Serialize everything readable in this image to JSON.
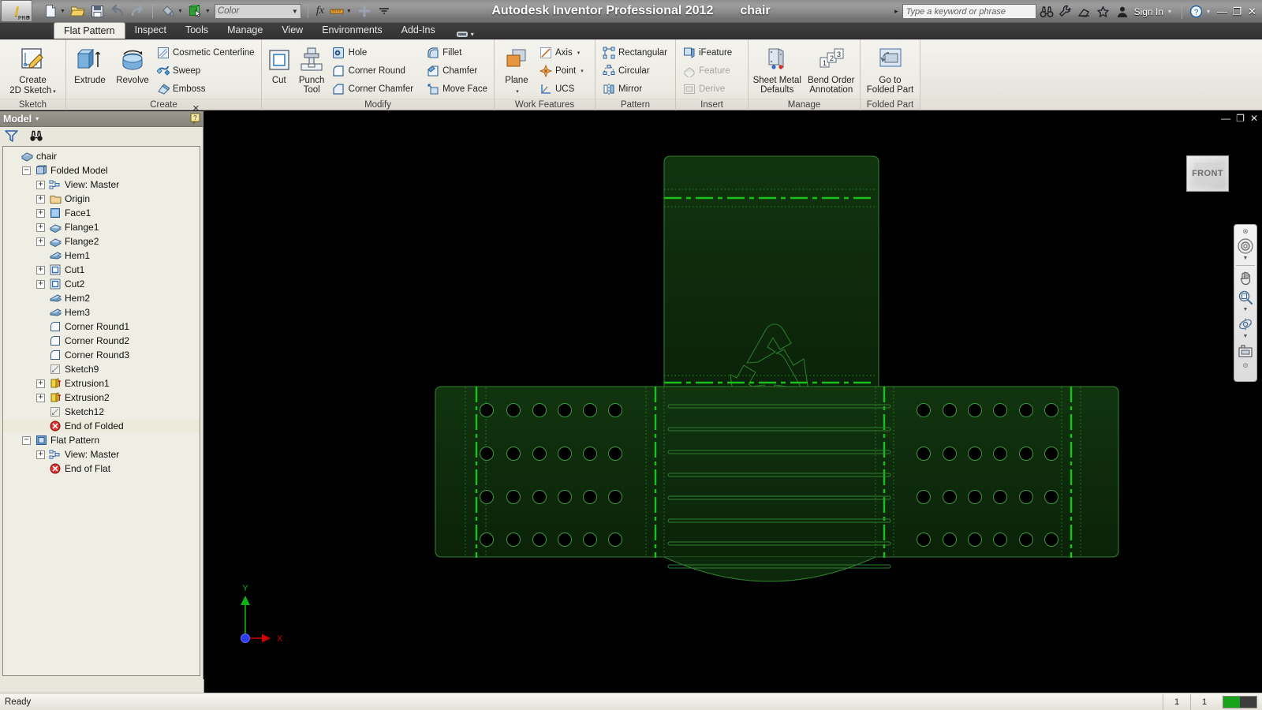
{
  "titlebar": {
    "app_logo": "inventor-logo",
    "pro_badge": "PRO",
    "quick_access": [
      {
        "name": "new-file",
        "icon": "new-document-icon",
        "has_dropdown": true
      },
      {
        "name": "open-file",
        "icon": "open-folder-icon",
        "has_dropdown": false
      },
      {
        "name": "save-file",
        "icon": "save-disk-icon",
        "has_dropdown": false
      },
      {
        "name": "undo",
        "icon": "undo-arrow-icon",
        "has_dropdown": false
      },
      {
        "name": "redo",
        "icon": "redo-arrow-icon",
        "has_dropdown": false
      },
      {
        "name": "appearance",
        "icon": "paint-bucket-icon",
        "has_dropdown": true
      },
      {
        "name": "material",
        "icon": "material-box-icon",
        "has_dropdown": true
      }
    ],
    "color_combo": {
      "value": "Color",
      "arrow": "▼"
    },
    "fx_label": "fx",
    "measure_icon": "ruler-icon",
    "plus_icon": "plus-icon",
    "more_icon": "more-arrow-icon",
    "title": "Autodesk Inventor Professional 2012",
    "document": "chair",
    "doc_caret": "▸",
    "search_placeholder": "Type a keyword or phrase",
    "right_icons": [
      {
        "name": "search-binoculars",
        "icon": "binoculars-icon"
      },
      {
        "name": "help-wrench",
        "icon": "wrench-icon"
      },
      {
        "name": "subscription",
        "icon": "satellite-icon"
      },
      {
        "name": "favorites",
        "icon": "star-icon"
      }
    ],
    "sign_in": "Sign In",
    "sign_in_caret": "▾",
    "help_caret": "▾",
    "window_buttons": {
      "minimize": "—",
      "restore": "❐",
      "close": "✕"
    }
  },
  "tabs": {
    "items": [
      {
        "label": "Flat Pattern",
        "active": true
      },
      {
        "label": "Inspect",
        "active": false
      },
      {
        "label": "Tools",
        "active": false
      },
      {
        "label": "Manage",
        "active": false
      },
      {
        "label": "View",
        "active": false
      },
      {
        "label": "Environments",
        "active": false
      },
      {
        "label": "Add-Ins",
        "active": false
      }
    ],
    "extra_icon": "panel-display-icon",
    "extra_caret": "▾"
  },
  "ribbon": {
    "panels": [
      {
        "title": "Sketch",
        "big_buttons": [
          {
            "label": "Create\n2D Sketch",
            "label_line1": "Create",
            "label_line2": "2D Sketch",
            "icon": "create-sketch-icon",
            "has_dropdown": true
          }
        ],
        "small_buttons": []
      },
      {
        "title": "Create",
        "big_buttons": [
          {
            "label_line1": "Extrude",
            "label_line2": "",
            "icon": "extrude-icon",
            "has_dropdown": false
          },
          {
            "label_line1": "Revolve",
            "label_line2": "",
            "icon": "revolve-icon",
            "has_dropdown": false
          }
        ],
        "small_buttons": [
          {
            "label": "Cosmetic Centerline",
            "icon": "cosmetic-centerline-icon",
            "disabled": false
          },
          {
            "label": "Sweep",
            "icon": "sweep-icon",
            "disabled": false
          },
          {
            "label": "Emboss",
            "icon": "emboss-icon",
            "disabled": false
          }
        ]
      },
      {
        "title": "Modify",
        "big_buttons": [
          {
            "label_line1": "Cut",
            "label_line2": "",
            "icon": "cut-icon",
            "has_dropdown": false
          },
          {
            "label_line1": "Punch",
            "label_line2": "Tool",
            "icon": "punch-tool-icon",
            "has_dropdown": false
          }
        ],
        "small_buttons": [
          {
            "label": "Hole",
            "icon": "hole-icon",
            "disabled": false
          },
          {
            "label": "Corner Round",
            "icon": "corner-round-icon",
            "disabled": false
          },
          {
            "label": "Corner Chamfer",
            "icon": "corner-chamfer-icon",
            "disabled": false
          }
        ],
        "small_buttons2": [
          {
            "label": "Fillet",
            "icon": "fillet-icon",
            "disabled": false
          },
          {
            "label": "Chamfer",
            "icon": "chamfer-icon",
            "disabled": false
          },
          {
            "label": "Move Face",
            "icon": "move-face-icon",
            "disabled": false
          }
        ]
      },
      {
        "title": "Work Features",
        "big_buttons": [
          {
            "label_line1": "Plane",
            "label_line2": "",
            "icon": "work-plane-icon",
            "has_dropdown": true
          }
        ],
        "small_buttons": [
          {
            "label": "Axis",
            "icon": "work-axis-icon",
            "disabled": false,
            "has_dropdown": true
          },
          {
            "label": "Point",
            "icon": "work-point-icon",
            "disabled": false,
            "has_dropdown": true
          },
          {
            "label": "UCS",
            "icon": "ucs-icon",
            "disabled": false,
            "has_dropdown": false
          }
        ]
      },
      {
        "title": "Pattern",
        "small_buttons": [
          {
            "label": "Rectangular",
            "icon": "rectangular-pattern-icon",
            "disabled": false
          },
          {
            "label": "Circular",
            "icon": "circular-pattern-icon",
            "disabled": false
          },
          {
            "label": "Mirror",
            "icon": "mirror-icon",
            "disabled": false
          }
        ]
      },
      {
        "title": "Insert",
        "small_buttons": [
          {
            "label": "iFeature",
            "icon": "ifeature-icon",
            "disabled": false
          },
          {
            "label": "Feature",
            "icon": "feature-icon",
            "disabled": true
          },
          {
            "label": "Derive",
            "icon": "derive-icon",
            "disabled": true
          }
        ]
      },
      {
        "title": "Manage",
        "big_buttons": [
          {
            "label_line1": "Sheet Metal",
            "label_line2": "Defaults",
            "icon": "sheet-metal-defaults-icon",
            "has_dropdown": false
          },
          {
            "label_line1": "Bend Order",
            "label_line2": "Annotation",
            "icon": "bend-order-annotation-icon",
            "has_dropdown": false
          }
        ]
      },
      {
        "title": "Folded Part",
        "big_buttons": [
          {
            "label_line1": "Go to",
            "label_line2": "Folded Part",
            "icon": "go-to-folded-part-icon",
            "has_dropdown": false
          }
        ]
      }
    ]
  },
  "browser": {
    "header_title": "Model",
    "header_caret": "▾",
    "help_icon": "help-tooltip-icon",
    "close_icon": "✕",
    "toolbar": [
      {
        "name": "filter",
        "icon": "filter-funnel-icon"
      },
      {
        "name": "find",
        "icon": "binoculars-icon"
      }
    ],
    "tree": [
      {
        "label": "chair",
        "depth": 0,
        "icon": "part-icon",
        "expander": "none",
        "highlight": false
      },
      {
        "label": "Folded Model",
        "depth": 1,
        "icon": "folded-model-icon",
        "expander": "minus",
        "highlight": false
      },
      {
        "label": "View: Master",
        "depth": 2,
        "icon": "view-master-icon",
        "expander": "plus",
        "highlight": false
      },
      {
        "label": "Origin",
        "depth": 2,
        "icon": "origin-folder-icon",
        "expander": "plus",
        "highlight": false
      },
      {
        "label": "Face1",
        "depth": 2,
        "icon": "face-icon",
        "expander": "plus",
        "highlight": false
      },
      {
        "label": "Flange1",
        "depth": 2,
        "icon": "flange-icon",
        "expander": "plus",
        "highlight": false
      },
      {
        "label": "Flange2",
        "depth": 2,
        "icon": "flange-icon",
        "expander": "plus",
        "highlight": false
      },
      {
        "label": "Hem1",
        "depth": 2,
        "icon": "hem-icon",
        "expander": "none",
        "highlight": false
      },
      {
        "label": "Cut1",
        "depth": 2,
        "icon": "cut-feature-icon",
        "expander": "plus",
        "highlight": false
      },
      {
        "label": "Cut2",
        "depth": 2,
        "icon": "cut-feature-icon",
        "expander": "plus",
        "highlight": false
      },
      {
        "label": "Hem2",
        "depth": 2,
        "icon": "hem-icon",
        "expander": "none",
        "highlight": false
      },
      {
        "label": "Hem3",
        "depth": 2,
        "icon": "hem-icon",
        "expander": "none",
        "highlight": false
      },
      {
        "label": "Corner Round1",
        "depth": 2,
        "icon": "corner-round-icon",
        "expander": "none",
        "highlight": false
      },
      {
        "label": "Corner Round2",
        "depth": 2,
        "icon": "corner-round-icon",
        "expander": "none",
        "highlight": false
      },
      {
        "label": "Corner Round3",
        "depth": 2,
        "icon": "corner-round-icon",
        "expander": "none",
        "highlight": false
      },
      {
        "label": "Sketch9",
        "depth": 2,
        "icon": "sketch-icon",
        "expander": "none",
        "highlight": false
      },
      {
        "label": "Extrusion1",
        "depth": 2,
        "icon": "extrusion-icon",
        "expander": "plus",
        "highlight": false
      },
      {
        "label": "Extrusion2",
        "depth": 2,
        "icon": "extrusion-icon",
        "expander": "plus",
        "highlight": false
      },
      {
        "label": "Sketch12",
        "depth": 2,
        "icon": "sketch-icon",
        "expander": "none",
        "highlight": false
      },
      {
        "label": "End of Folded",
        "depth": 2,
        "icon": "end-of-part-icon",
        "expander": "none",
        "highlight": true
      },
      {
        "label": "Flat Pattern",
        "depth": 1,
        "icon": "flat-pattern-icon",
        "expander": "minus",
        "highlight": false
      },
      {
        "label": "View: Master",
        "depth": 2,
        "icon": "view-master-icon",
        "expander": "plus",
        "highlight": false
      },
      {
        "label": "End of Flat",
        "depth": 2,
        "icon": "end-of-part-icon",
        "expander": "none",
        "highlight": false
      }
    ]
  },
  "graphics": {
    "window_buttons": {
      "minimize": "—",
      "restore": "❐",
      "close": "✕"
    },
    "viewcube_label": "FRONT",
    "navbar": [
      {
        "name": "steering-wheel",
        "icon": "steering-wheel-icon",
        "has_dropdown": true
      },
      {
        "name": "pan",
        "icon": "pan-hand-icon",
        "has_dropdown": false
      },
      {
        "name": "zoom",
        "icon": "zoom-magnifier-icon",
        "has_dropdown": true
      },
      {
        "name": "orbit",
        "icon": "orbit-icon",
        "has_dropdown": true
      },
      {
        "name": "look-at",
        "icon": "look-at-camera-icon",
        "has_dropdown": false
      }
    ],
    "navbar_close": "⊗",
    "navbar_menu": "⊜",
    "axis": {
      "x_label": "X",
      "y_label": "Y",
      "x_color": "#d00000",
      "y_color": "#00c000",
      "origin_color": "#2a3df0"
    },
    "model_colors": {
      "face_fill": "#0d2b0d",
      "edge": "#2f7f2f",
      "bend_line": "#19c219",
      "dotted_line": "#23a023",
      "background": "#000000"
    },
    "emboss_symbol": "recycle-symbol"
  },
  "statusbar": {
    "ready": "Ready",
    "cell1": "1",
    "cell2": "1",
    "color_swatch": [
      "#19a319",
      "#3d3d3d"
    ]
  }
}
